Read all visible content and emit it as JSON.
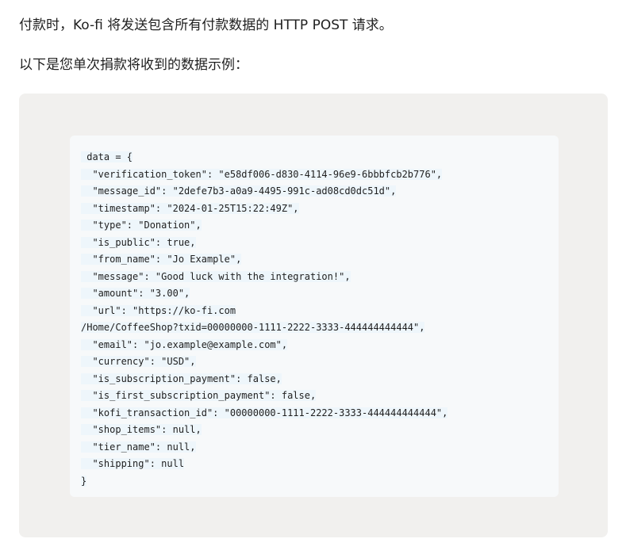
{
  "intro": {
    "paragraph_1": "付款时，Ko-fi 将发送包含所有付款数据的 HTTP POST 请求。",
    "paragraph_2": "以下是您单次捐款将收到的数据示例："
  },
  "code": {
    "lines": [
      " data = {",
      "  \"verification_token\": \"e58df006-d830-4114-96e9-6bbbfcb2b776\",",
      "  \"message_id\": \"2defe7b3-a0a9-4495-991c-ad08cd0dc51d\",",
      "  \"timestamp\": \"2024-01-25T15:22:49Z\",",
      "  \"type\": \"Donation\",",
      "  \"is_public\": true,",
      "  \"from_name\": \"Jo Example\",",
      "  \"message\": \"Good luck with the integration!\",",
      "  \"amount\": \"3.00\",",
      "  \"url\": \"https://ko-fi.com",
      "/Home/CoffeeShop?txid=00000000-1111-2222-3333-444444444444\",",
      "  \"email\": \"jo.example@example.com\",",
      "  \"currency\": \"USD\",",
      "  \"is_subscription_payment\": false,",
      "  \"is_first_subscription_payment\": false,",
      "  \"kofi_transaction_id\": \"00000000-1111-2222-3333-444444444444\",",
      "  \"shop_items\": null,",
      "  \"tier_name\": null,",
      "  \"shipping\": null",
      "}"
    ]
  }
}
